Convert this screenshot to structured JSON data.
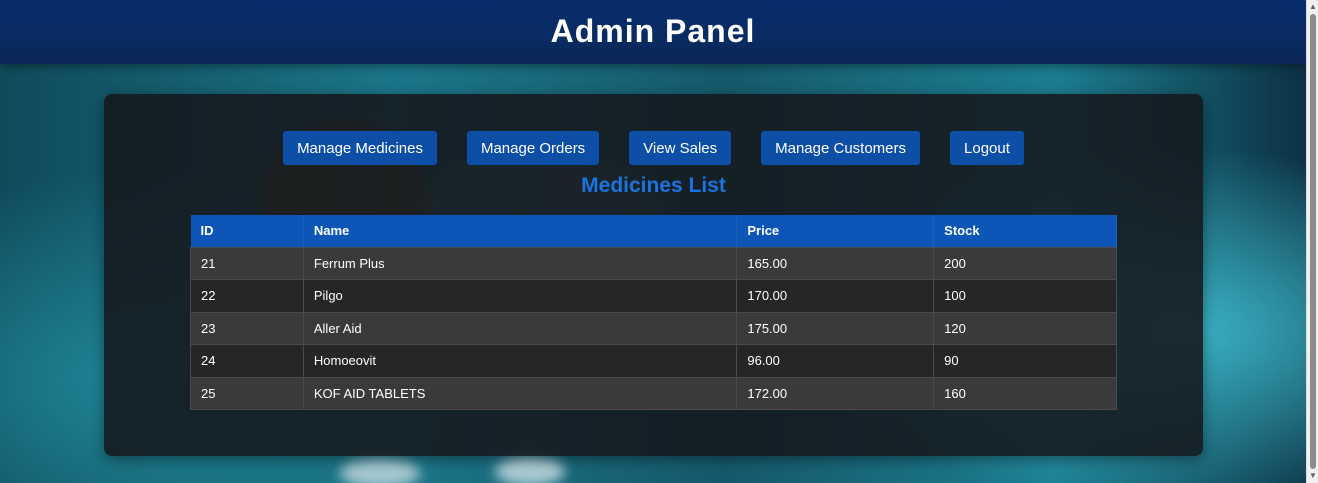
{
  "header": {
    "title": "Admin Panel"
  },
  "nav": {
    "buttons": [
      {
        "label": "Manage Medicines"
      },
      {
        "label": "Manage Orders"
      },
      {
        "label": "View Sales"
      },
      {
        "label": "Manage Customers"
      },
      {
        "label": "Logout"
      }
    ]
  },
  "main": {
    "section_title": "Medicines List",
    "table": {
      "columns": [
        "ID",
        "Name",
        "Price",
        "Stock"
      ],
      "rows": [
        [
          "21",
          "Ferrum Plus",
          "165.00",
          "200"
        ],
        [
          "22",
          "Pilgo",
          "170.00",
          "100"
        ],
        [
          "23",
          "Aller Aid",
          "175.00",
          "120"
        ],
        [
          "24",
          "Homoeovit",
          "96.00",
          "90"
        ],
        [
          "25",
          "KOF AID TABLETS",
          "172.00",
          "160"
        ]
      ]
    }
  },
  "scrollbar": {
    "up_icon": "triangle-up-icon",
    "down_icon": "triangle-down-icon"
  },
  "colors": {
    "header_bg": "#0a2c63",
    "button_bg": "#0d4fa6",
    "table_header_bg": "#0d56b8",
    "section_title": "#1b73e0"
  }
}
